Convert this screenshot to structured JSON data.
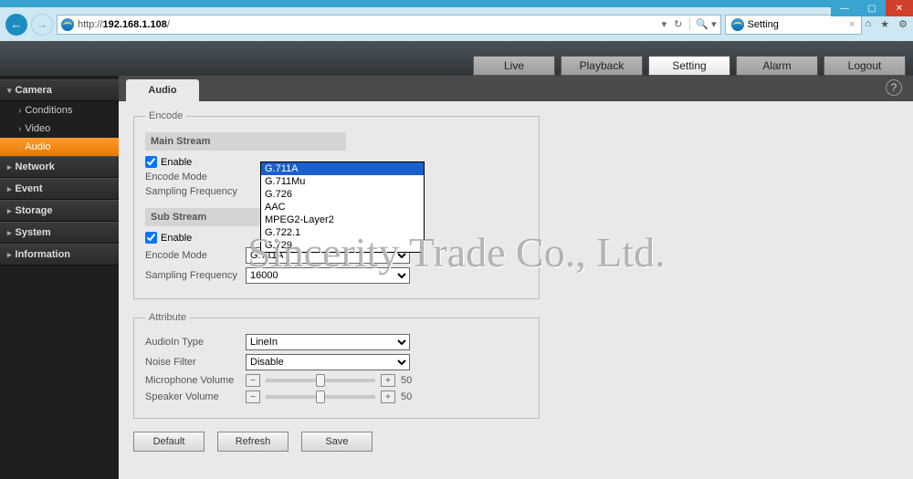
{
  "window": {
    "url_prefix": "http://",
    "url_host": "192.168.1.108",
    "url_suffix": "/",
    "tab_title": "Setting"
  },
  "top_tabs": {
    "live": "Live",
    "playback": "Playback",
    "setting": "Setting",
    "alarm": "Alarm",
    "logout": "Logout"
  },
  "sidebar": {
    "camera": "Camera",
    "items": {
      "conditions": "Conditions",
      "video": "Video",
      "audio": "Audio"
    },
    "network": "Network",
    "event": "Event",
    "storage": "Storage",
    "system": "System",
    "information": "Information"
  },
  "page_tab": "Audio",
  "encode": {
    "legend": "Encode",
    "main_head": "Main Stream",
    "enable": "Enable",
    "encode_mode": "Encode Mode",
    "sampling": "Sampling Frequency",
    "options": [
      "G.711A",
      "G.711Mu",
      "G.726",
      "AAC",
      "MPEG2-Layer2",
      "G.722.1",
      "G.729"
    ],
    "sub_head": "Sub Stream",
    "sub_mode_value": "G.711A",
    "sub_sampling_value": "16000"
  },
  "attribute": {
    "legend": "Attribute",
    "audioin": "AudioIn Type",
    "audioin_value": "LineIn",
    "noise": "Noise Filter",
    "noise_value": "Disable",
    "mic": "Microphone Volume",
    "spk": "Speaker Volume",
    "mic_val": "50",
    "spk_val": "50"
  },
  "buttons": {
    "default": "Default",
    "refresh": "Refresh",
    "save": "Save"
  },
  "watermark": "Sincerity Trade Co., Ltd."
}
